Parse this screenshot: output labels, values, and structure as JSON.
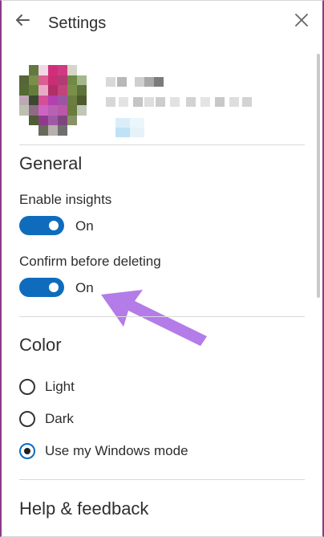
{
  "header": {
    "title": "Settings"
  },
  "icons": {
    "back": "back-arrow-icon",
    "close": "close-icon"
  },
  "general": {
    "section_title": "General",
    "enable_insights_label": "Enable insights",
    "enable_insights_state": "On",
    "confirm_delete_label": "Confirm before deleting",
    "confirm_delete_state": "On"
  },
  "color": {
    "section_title": "Color",
    "options": [
      "Light",
      "Dark",
      "Use my Windows mode"
    ],
    "selected": "Use my Windows mode"
  },
  "help": {
    "section_title": "Help & feedback"
  },
  "colors": {
    "accent": "#0f6cbd",
    "annotation": "#b37ce8",
    "frame": "#8b3a86"
  }
}
